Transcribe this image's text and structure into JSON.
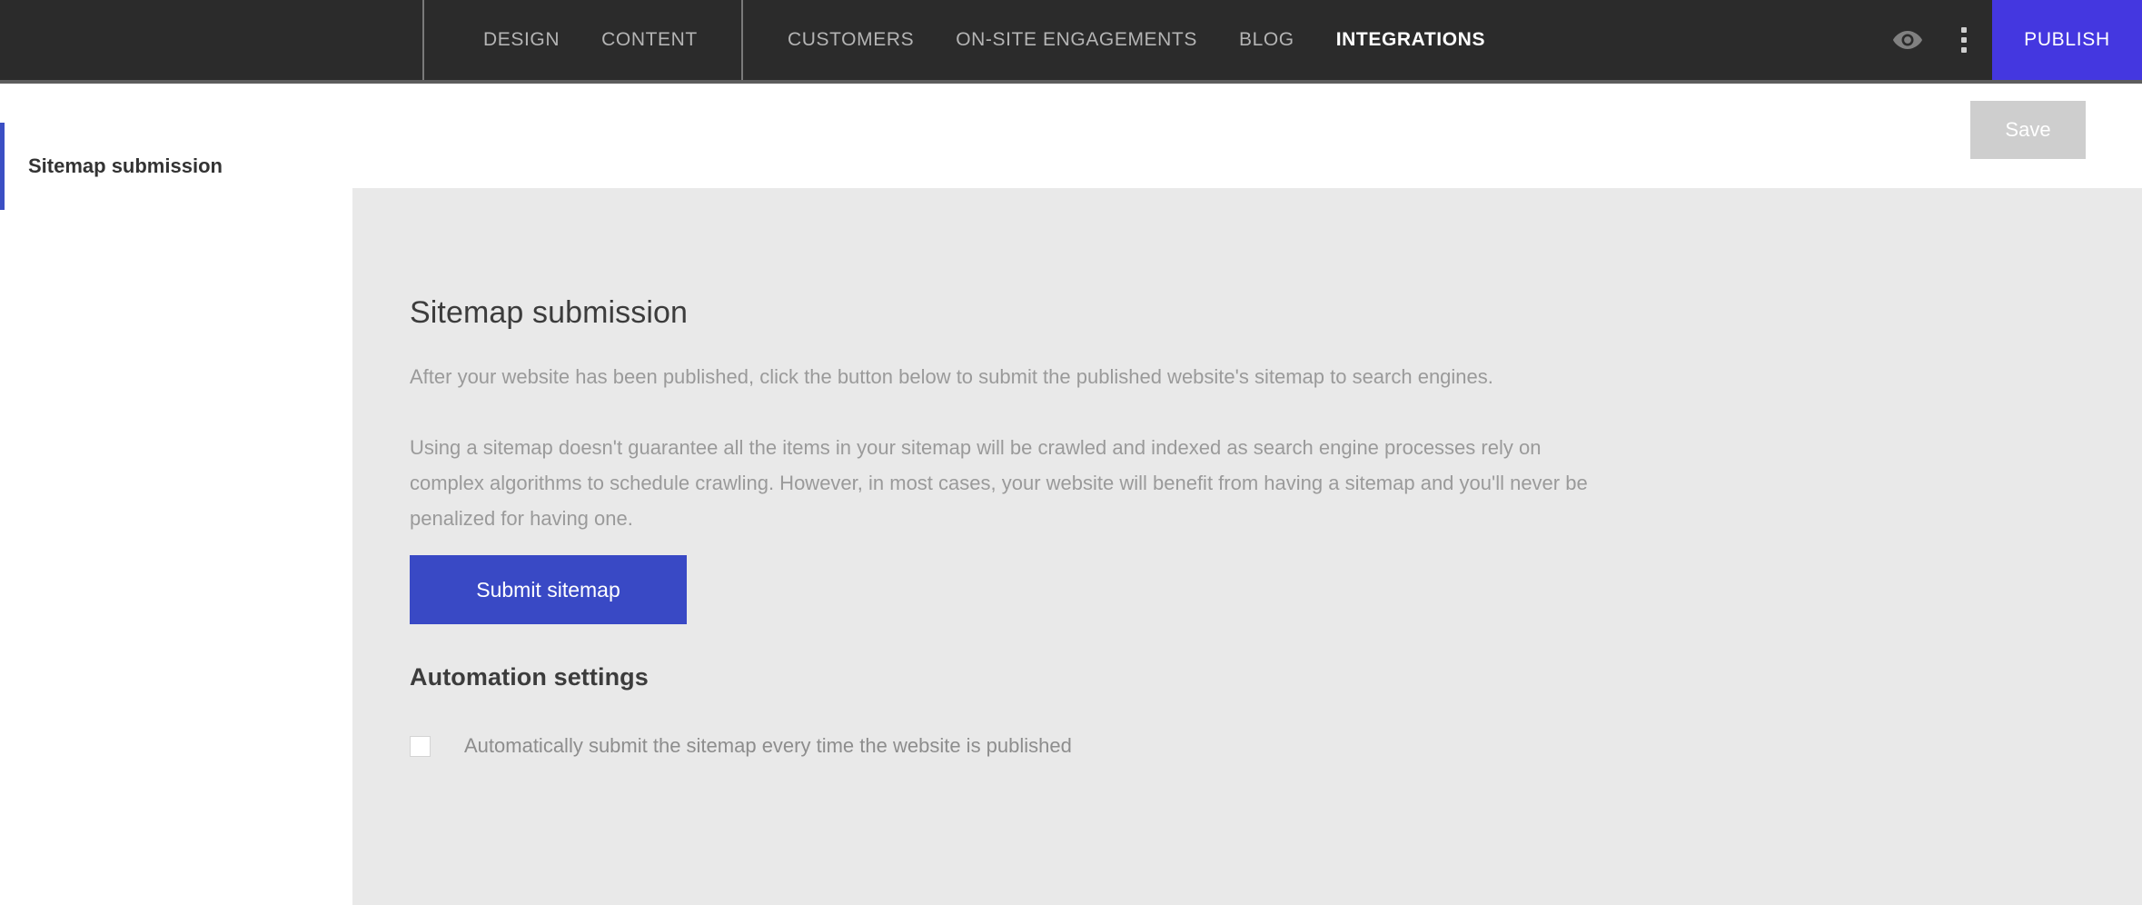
{
  "topbar": {
    "nav_group_1": [
      {
        "label": "DESIGN",
        "active": false,
        "name": "nav-item-design"
      },
      {
        "label": "CONTENT",
        "active": false,
        "name": "nav-item-content"
      }
    ],
    "nav_group_2": [
      {
        "label": "CUSTOMERS",
        "active": false,
        "name": "nav-item-customers"
      },
      {
        "label": "ON-SITE ENGAGEMENTS",
        "active": false,
        "name": "nav-item-on-site-engagements"
      },
      {
        "label": "BLOG",
        "active": false,
        "name": "nav-item-blog"
      },
      {
        "label": "INTEGRATIONS",
        "active": true,
        "name": "nav-item-integrations"
      }
    ],
    "preview_icon": "eye-icon",
    "overflow_icon": "three-dots-vertical-icon",
    "publish_label": "PUBLISH",
    "publish_color": "#4437e0",
    "background_color": "#2b2b2b"
  },
  "subbar": {
    "sidebar_item_label": "Sitemap submission",
    "sidebar_accent_color": "#3b4fc4",
    "save_label": "Save",
    "save_disabled": true,
    "save_color": "#cecece"
  },
  "main": {
    "panel_color": "#e9e9e9",
    "title": "Sitemap submission",
    "paragraph_1": "After your website has been published, click the button below to submit the published website's sitemap to search engines.",
    "paragraph_2": "Using a sitemap doesn't guarantee all the items in your sitemap will be crawled and indexed as search engine processes rely on complex algorithms to schedule crawling. However, in most cases, your website will benefit from having a sitemap and you'll never be penalized for having one.",
    "submit_button_label": "Submit sitemap",
    "submit_button_color": "#3949c5",
    "automation_heading": "Automation settings",
    "automation_checkbox_label": "Automatically submit the sitemap every time the website is published",
    "automation_checkbox_checked": false
  }
}
